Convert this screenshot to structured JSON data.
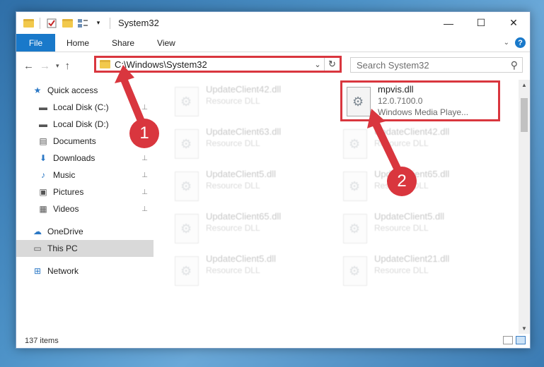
{
  "title": "System32",
  "ribbon": {
    "file": "File",
    "tabs": [
      "Home",
      "Share",
      "View"
    ],
    "help": "?"
  },
  "window_controls": {
    "minimize": "—",
    "maximize": "☐",
    "close": "✕"
  },
  "address": {
    "path": "C:\\Windows\\System32",
    "refresh": "↻"
  },
  "search": {
    "placeholder": "Search System32"
  },
  "nav": {
    "back": "←",
    "forward": "→",
    "up": "↑",
    "items": [
      {
        "label": "Quick access",
        "icon": "star-icon",
        "glyph": "★",
        "pinned": false
      },
      {
        "label": "Local Disk (C:)",
        "icon": "drive-icon",
        "glyph": "▬",
        "pinned": true
      },
      {
        "label": "Local Disk (D:)",
        "icon": "drive-icon",
        "glyph": "▬",
        "pinned": true
      },
      {
        "label": "Documents",
        "icon": "documents-icon",
        "glyph": "▤",
        "pinned": true
      },
      {
        "label": "Downloads",
        "icon": "download-icon",
        "glyph": "⬇",
        "pinned": true
      },
      {
        "label": "Music",
        "icon": "music-icon",
        "glyph": "♪",
        "pinned": true
      },
      {
        "label": "Pictures",
        "icon": "pictures-icon",
        "glyph": "▣",
        "pinned": true
      },
      {
        "label": "Videos",
        "icon": "video-icon",
        "glyph": "▦",
        "pinned": true
      },
      {
        "label": "OneDrive",
        "icon": "cloud-icon",
        "glyph": "☁",
        "pinned": false
      },
      {
        "label": "This PC",
        "icon": "computer-icon",
        "glyph": "▭",
        "pinned": false,
        "selected": true
      },
      {
        "label": "Network",
        "icon": "network-icon",
        "glyph": "⊞",
        "pinned": false
      }
    ]
  },
  "files": [
    {
      "name": "UpdateClient42.dll",
      "sub": "Resource DLL",
      "faded": true
    },
    {
      "name": "mpvis.dll",
      "sub": "12.0.7100.0",
      "sub2": "Windows Media Playe...",
      "faded": false,
      "highlight": true
    },
    {
      "name": "UpdateClient63.dll",
      "sub": "Resource DLL",
      "faded": true
    },
    {
      "name": "UpdateClient42.dll",
      "sub": "Resource DLL",
      "faded": true
    },
    {
      "name": "UpdateClient5.dll",
      "sub": "Resource DLL",
      "faded": true
    },
    {
      "name": "UpdateClient65.dll",
      "sub": "Resource DLL",
      "faded": true
    },
    {
      "name": "UpdateClient65.dll",
      "sub": "Resource DLL",
      "faded": true
    },
    {
      "name": "UpdateClient5.dll",
      "sub": "Resource DLL",
      "faded": true
    },
    {
      "name": "UpdateClient5.dll",
      "sub": "Resource DLL",
      "faded": true
    },
    {
      "name": "UpdateClient21.dll",
      "sub": "Resource DLL",
      "faded": true
    }
  ],
  "status": {
    "items": "137 items"
  },
  "annotations": {
    "step1": "1",
    "step2": "2",
    "color": "#d9363e"
  }
}
